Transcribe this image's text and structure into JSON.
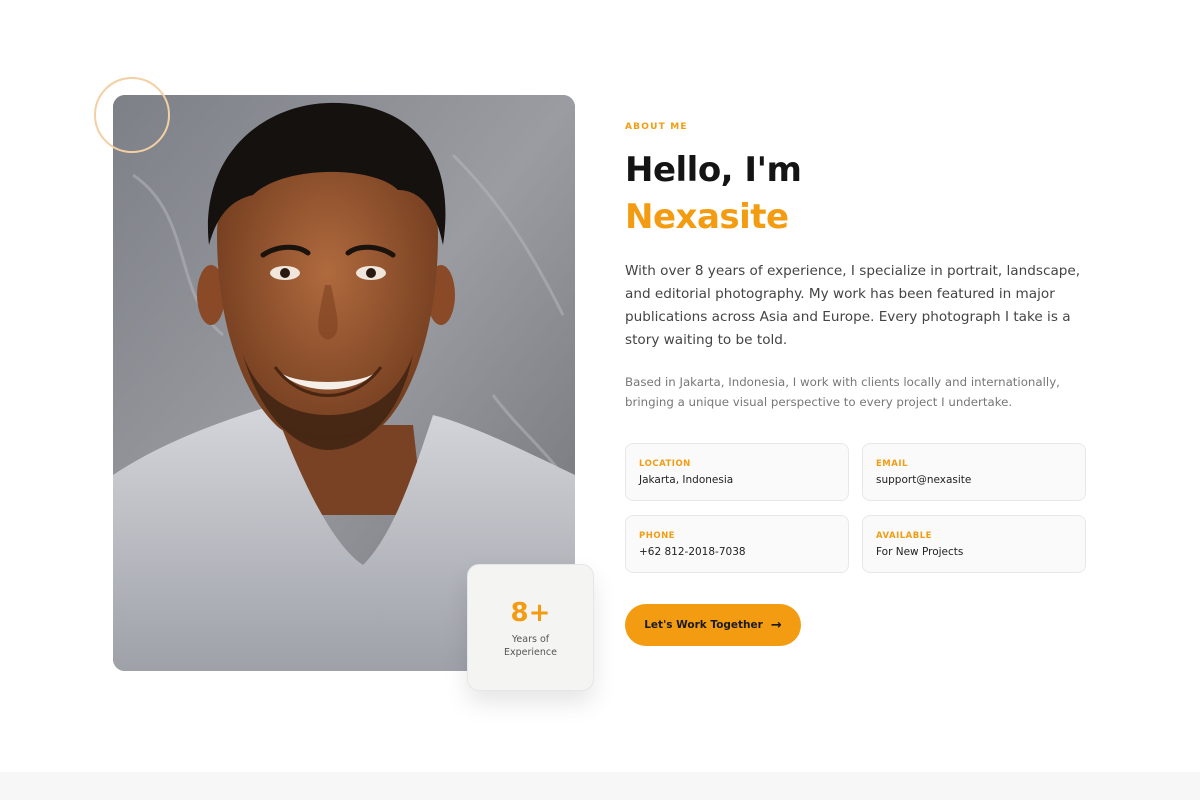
{
  "about": {
    "eyebrow": "ABOUT ME",
    "greeting": "Hello, I'm",
    "name": "Nexasite",
    "lead": "With over 8 years of experience, I specialize in portrait, landscape, and editorial photography. My work has been featured in major publications across Asia and Europe. Every photograph I take is a story waiting to be told.",
    "sub": "Based in Jakarta, Indonesia, I work with clients locally and internationally, bringing a unique visual perspective to every project I undertake."
  },
  "experience": {
    "number": "8+",
    "label": "Years of Experience"
  },
  "info": [
    {
      "label": "LOCATION",
      "value": "Jakarta, Indonesia"
    },
    {
      "label": "EMAIL",
      "value": "support@nexasite"
    },
    {
      "label": "PHONE",
      "value": "+62 812-2018-7038"
    },
    {
      "label": "AVAILABLE",
      "value": "For New Projects"
    }
  ],
  "cta": {
    "label": "Let's Work Together",
    "icon": "arrow-right-icon"
  },
  "colors": {
    "accent": "#f39c12",
    "heading": "#141414",
    "body": "#444444"
  }
}
